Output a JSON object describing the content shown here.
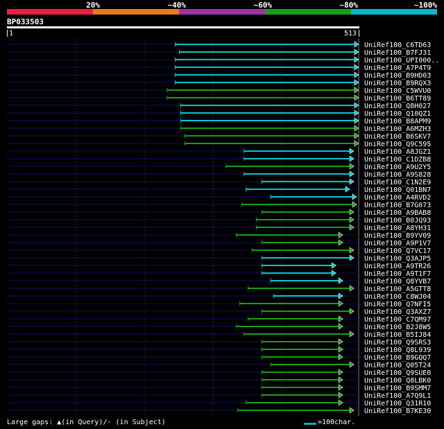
{
  "legend": [
    {
      "label": "20%",
      "color": "#e8203a"
    },
    {
      "label": "~40%",
      "color": "#e87a20"
    },
    {
      "label": "~60%",
      "color": "#a030a8"
    },
    {
      "label": "~80%",
      "color": "#18a018"
    },
    {
      "label": "~100%",
      "color": "#00b8c8"
    }
  ],
  "query": {
    "name": "BP033503",
    "start": "1",
    "end": "513",
    "length": 513
  },
  "hits": [
    {
      "name": "UniRef100_C6TD63",
      "start": 246,
      "end": 513,
      "color": "cyan"
    },
    {
      "name": "UniRef100_B7FJ31",
      "start": 252,
      "end": 513,
      "color": "cyan"
    },
    {
      "name": "UniRef100_UPI000..",
      "start": 246,
      "end": 513,
      "color": "cyan"
    },
    {
      "name": "UniRef100_A7P4T9",
      "start": 246,
      "end": 513,
      "color": "cyan"
    },
    {
      "name": "UniRef100_B9HD03",
      "start": 246,
      "end": 513,
      "color": "cyan"
    },
    {
      "name": "UniRef100_B9RQX3",
      "start": 246,
      "end": 513,
      "color": "cyan"
    },
    {
      "name": "UniRef100_C5WVU0",
      "start": 234,
      "end": 513,
      "color": "green"
    },
    {
      "name": "UniRef100_B6TT89",
      "start": 234,
      "end": 513,
      "color": "green"
    },
    {
      "name": "UniRef100_Q8H027",
      "start": 254,
      "end": 513,
      "color": "cyan"
    },
    {
      "name": "UniRef100_Q10QZ1",
      "start": 254,
      "end": 513,
      "color": "cyan"
    },
    {
      "name": "UniRef100_B8APM9",
      "start": 254,
      "end": 513,
      "color": "cyan"
    },
    {
      "name": "UniRef100_A6MZH3",
      "start": 254,
      "end": 513,
      "color": "green"
    },
    {
      "name": "UniRef100_B6SKV7",
      "start": 260,
      "end": 513,
      "color": "green"
    },
    {
      "name": "UniRef100_Q9C595",
      "start": 260,
      "end": 513,
      "color": "green"
    },
    {
      "name": "UniRef100_A8JGZ1",
      "start": 346,
      "end": 506,
      "color": "cyan"
    },
    {
      "name": "UniRef100_C1DZB8",
      "start": 346,
      "end": 506,
      "color": "cyan"
    },
    {
      "name": "UniRef100_A9U2Y5",
      "start": 320,
      "end": 506,
      "color": "green"
    },
    {
      "name": "UniRef100_A9S828",
      "start": 346,
      "end": 506,
      "color": "cyan"
    },
    {
      "name": "UniRef100_C1N2E9",
      "start": 372,
      "end": 506,
      "color": "cyan"
    },
    {
      "name": "UniRef100_Q01BN7",
      "start": 349,
      "end": 500,
      "color": "cyan"
    },
    {
      "name": "UniRef100_A4RVD2",
      "start": 385,
      "end": 510,
      "color": "cyan"
    },
    {
      "name": "UniRef100_B7G073",
      "start": 343,
      "end": 510,
      "color": "green"
    },
    {
      "name": "UniRef100_A9BAB8",
      "start": 372,
      "end": 506,
      "color": "green"
    },
    {
      "name": "UniRef100_B0JQ93",
      "start": 364,
      "end": 506,
      "color": "green"
    },
    {
      "name": "UniRef100_A8YH31",
      "start": 364,
      "end": 506,
      "color": "green"
    },
    {
      "name": "UniRef100_B9YV09",
      "start": 335,
      "end": 490,
      "color": "green"
    },
    {
      "name": "UniRef100_A9P1V7",
      "start": 372,
      "end": 490,
      "color": "green"
    },
    {
      "name": "UniRef100_Q7VC17",
      "start": 358,
      "end": 506,
      "color": "green"
    },
    {
      "name": "UniRef100_Q3AJP5",
      "start": 372,
      "end": 506,
      "color": "cyan"
    },
    {
      "name": "UniRef100_A9TR26",
      "start": 372,
      "end": 480,
      "color": "cyan"
    },
    {
      "name": "UniRef100_A9T1F7",
      "start": 372,
      "end": 480,
      "color": "cyan"
    },
    {
      "name": "UniRef100_Q8YVB7",
      "start": 385,
      "end": 490,
      "color": "cyan"
    },
    {
      "name": "UniRef100_A5GTT8",
      "start": 352,
      "end": 506,
      "color": "green"
    },
    {
      "name": "UniRef100_C8WJ04",
      "start": 389,
      "end": 490,
      "color": "cyan"
    },
    {
      "name": "UniRef100_Q7NFI5",
      "start": 340,
      "end": 490,
      "color": "green"
    },
    {
      "name": "UniRef100_Q3AXZ7",
      "start": 372,
      "end": 506,
      "color": "green"
    },
    {
      "name": "UniRef100_C7QM97",
      "start": 352,
      "end": 490,
      "color": "green"
    },
    {
      "name": "UniRef100_B2J8W5",
      "start": 335,
      "end": 490,
      "color": "green"
    },
    {
      "name": "UniRef100_B5IJ84",
      "start": 346,
      "end": 506,
      "color": "green"
    },
    {
      "name": "UniRef100_Q9SRS3",
      "start": 372,
      "end": 490,
      "color": "green"
    },
    {
      "name": "UniRef100_Q8L939",
      "start": 372,
      "end": 490,
      "color": "green"
    },
    {
      "name": "UniRef100_B9GQQ7",
      "start": 372,
      "end": 490,
      "color": "green"
    },
    {
      "name": "UniRef100_Q05T24",
      "start": 385,
      "end": 506,
      "color": "green"
    },
    {
      "name": "UniRef100_Q9SUE0",
      "start": 372,
      "end": 490,
      "color": "green"
    },
    {
      "name": "UniRef100_Q8LBK0",
      "start": 372,
      "end": 490,
      "color": "green"
    },
    {
      "name": "UniRef100_B9SMM7",
      "start": 372,
      "end": 490,
      "color": "green"
    },
    {
      "name": "UniRef100_A7Q9L1",
      "start": 372,
      "end": 490,
      "color": "green"
    },
    {
      "name": "UniRef100_Q31R10",
      "start": 349,
      "end": 490,
      "color": "green"
    },
    {
      "name": "UniRef100_B7KE30",
      "start": 337,
      "end": 506,
      "color": "green"
    }
  ],
  "colors": {
    "cyan": "#00c8d8",
    "green": "#18a018",
    "background_line": "#101070",
    "grid": "#404040"
  },
  "footer": {
    "gaps_text": "Large gaps: ▲(in Query)/- (in Subject)",
    "scale_text": "=100char."
  }
}
